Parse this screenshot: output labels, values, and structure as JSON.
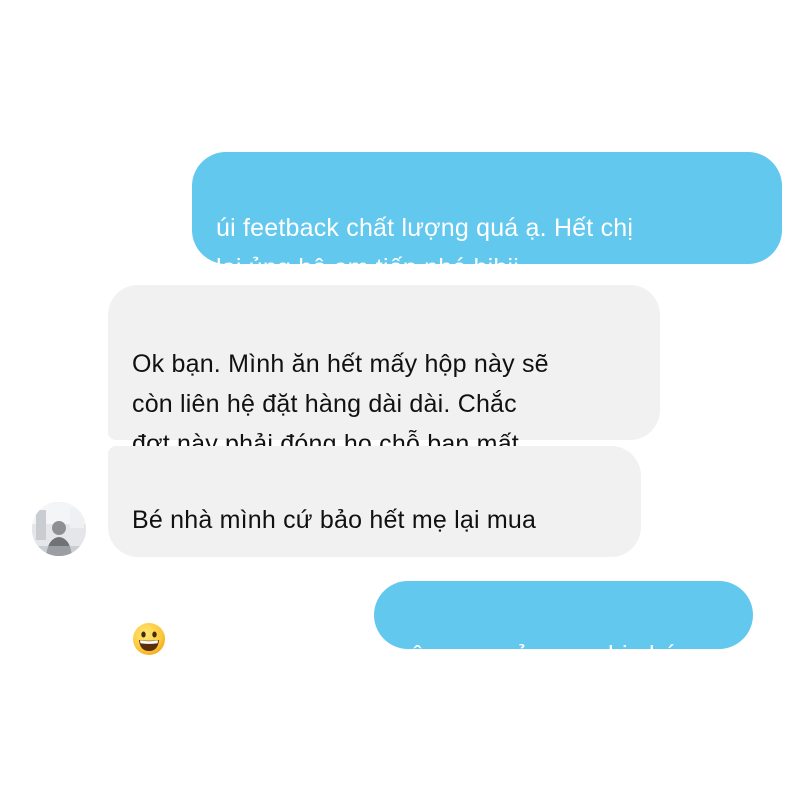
{
  "conversation": {
    "messages": [
      {
        "direction": "outgoing",
        "text": "úi feetback chất lượng quá ạ. Hết chị\nlại ủng hộ em tiếp nhé hihii"
      },
      {
        "direction": "incoming",
        "text": "Ok bạn. Mình ăn hết mấy hộp này sẽ\ncòn liên hệ đặt hàng dài dài. Chắc\nđợt này phải đóng họ chỗ bạn mất."
      },
      {
        "direction": "incoming",
        "text": "Bé nhà mình cứ bảo hết mẹ lại mua",
        "emoji": "grinning-face-emoji"
      },
      {
        "direction": "outgoing",
        "text": "vâng em cảm ơn chị nhé"
      }
    ],
    "contact_avatar": "contact-avatar-photo"
  },
  "colors": {
    "outgoing_bubble": "#62c8ee",
    "incoming_bubble": "#f1f1f1",
    "outgoing_text": "#ffffff",
    "incoming_text": "#111111",
    "background": "#ffffff"
  }
}
